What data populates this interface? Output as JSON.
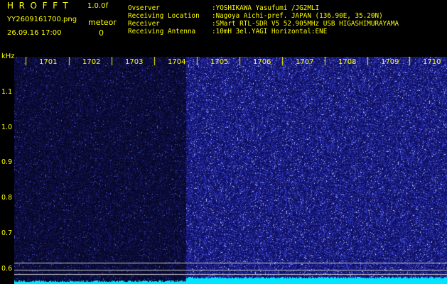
{
  "header": {
    "app_title": "HROFFT",
    "app_version": "1.0.0f",
    "file_name": "YY2609161700.png",
    "meteor_label": "meteor",
    "datetime": "26.09.16 17:00",
    "meteor_count": "0"
  },
  "station_info": [
    {
      "key": "Ovserver",
      "value": ":YOSHIKAWA Yasufumi /JG2MLI"
    },
    {
      "key": "Receiving Location",
      "value": ":Nagoya Aichi-pref. JAPAN (136.90E, 35.20N)"
    },
    {
      "key": "Receiver",
      "value": ":SMart RTL-SDR V5 52.905MHz USB HIGASHIMURAYAMA"
    },
    {
      "key": "Receiving Antenna",
      "value": ":10mH 3el.YAGI Horizontal:ENE"
    }
  ],
  "axes": {
    "y_unit": "kHz",
    "x_ticks": [
      "1701",
      "1702",
      "1703",
      "1704",
      "1705",
      "1706",
      "1707",
      "1708",
      "1709",
      "1710"
    ],
    "y_ticks": [
      "1.1",
      "1.0",
      "0.9",
      "0.8",
      "0.7",
      "0.6"
    ]
  },
  "colors": {
    "label": "#ffff00",
    "background": "#000000",
    "noise_dim": "#1a1a7a",
    "noise_bright": "#5b6cff",
    "spectrum": "#00e5ff",
    "guide_line": "#c8c8c8"
  }
}
